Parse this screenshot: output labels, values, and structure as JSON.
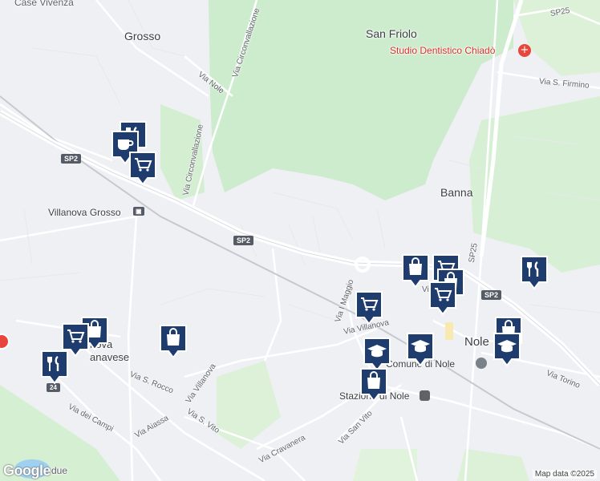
{
  "map": {
    "towns": {
      "grosso": "Grosso",
      "san_friolo": "San Friolo",
      "banna": "Banna",
      "nole": "Nole",
      "villanova_grosso": "Villanova Grosso",
      "villanova_canavese": "nova\nanavese",
      "case_vivenza": "Case Vivenza"
    },
    "streets": {
      "via_nole": "Via Nole",
      "via_circonvallazione_1": "Via Circonvallazione",
      "via_circonvallazione_2": "Via Circonvallazione",
      "via_s_firmino": "Via S. Firmino",
      "via_i_maggio": "Via I Maggio",
      "via_villanova_east": "Via Villanova",
      "via_villanova_west": "Via Villanova",
      "via_s_rocco": "Via S. Rocco",
      "via_dei_campi": "Via dei Campi",
      "via_aiassa": "Via Aiassa",
      "via_s_vito": "Via S. Vito",
      "via_san_vito": "Via San Vito",
      "via_cravanera": "Via Cravanera",
      "via_torino": "Via Torino",
      "via_short": "Vi"
    },
    "shields": {
      "sp2_left": "SP2",
      "sp2_mid": "SP2",
      "sp2_right": "SP2",
      "sp25_top": "SP25",
      "sp25_mid": "SP25",
      "sp24": "24"
    },
    "pois": {
      "studio_dentistico": "Studio Dentistico Chiadò",
      "comune_di_nole": "Comune di Nole",
      "stazione_di_nole": "Stazione di Nole",
      "due": "due"
    },
    "credit": "Map data ©2025",
    "logo": "Google"
  }
}
